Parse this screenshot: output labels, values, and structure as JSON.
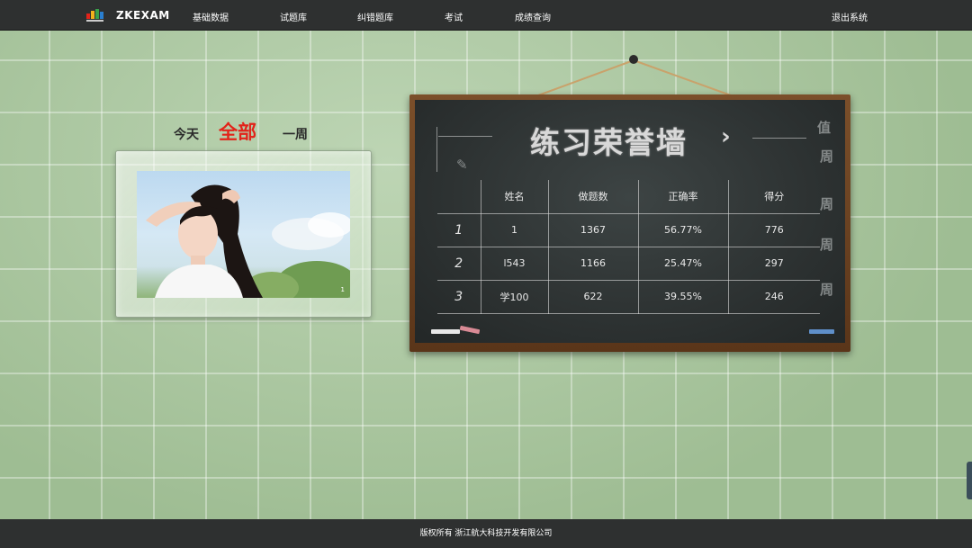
{
  "nav": {
    "logo_text": "ZKEXAM",
    "items": [
      "基础数据",
      "试题库",
      "纠错题库",
      "考试",
      "成绩查询"
    ],
    "logout": "退出系统"
  },
  "period": {
    "today": "今天",
    "all": "全部",
    "week": "一周",
    "selected": "全部"
  },
  "photo": {
    "badge": "1"
  },
  "board": {
    "title": "练习荣誉墙",
    "arrow": "›",
    "columns": [
      "姓名",
      "做题数",
      "正确率",
      "得分"
    ],
    "rows": [
      {
        "rank": "1",
        "name": "1",
        "done": "1367",
        "rate": "56.77%",
        "score": "776"
      },
      {
        "rank": "2",
        "name": "l543",
        "done": "1166",
        "rate": "25.47%",
        "score": "297"
      },
      {
        "rank": "3",
        "name": "学100",
        "done": "622",
        "rate": "39.55%",
        "score": "246"
      }
    ]
  },
  "footer": {
    "text": "版权所有  浙江航大科技开发有限公司"
  },
  "colors": {
    "accent": "#e2231a",
    "bar": "#2e3030",
    "board": "#2d3232",
    "wall": "#a7c79b"
  }
}
